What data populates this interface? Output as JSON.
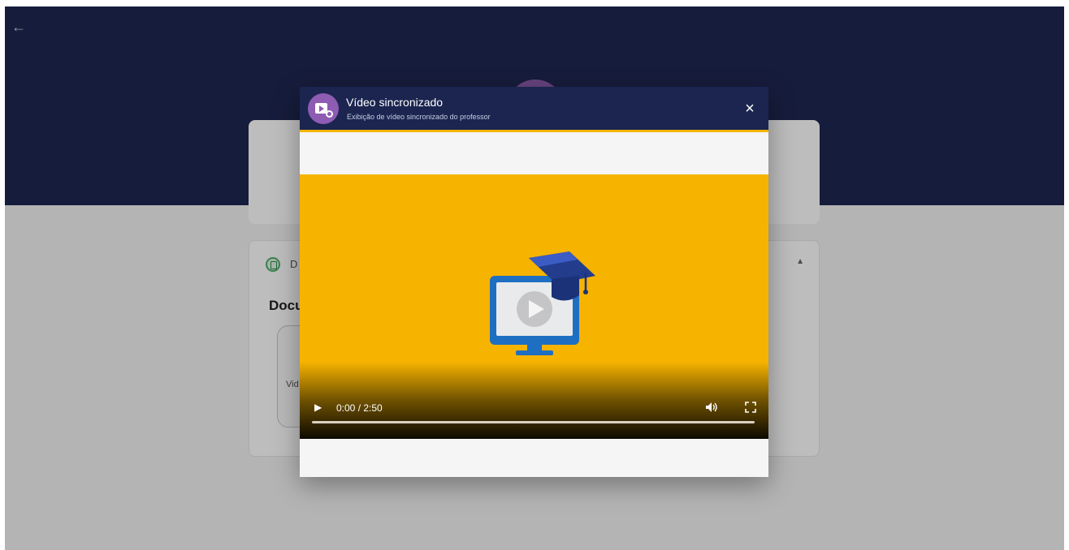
{
  "background": {
    "back_icon": "arrow-left-icon",
    "section_label_partial": "D",
    "document_title_partial": "Docu",
    "video_tile_label_partial": "Vid",
    "header_color": "#1e2650"
  },
  "modal": {
    "title": "Vídeo sincronizado",
    "subtitle": "Exibição de vídeo sincronizado do professor",
    "close_label": "×",
    "header_color": "#1b2550",
    "accent_color": "#f4b400",
    "icon_color": "#8e5cb2"
  },
  "player": {
    "play_label": "▶",
    "time": "0:00 / 2:50",
    "progress": 0,
    "background_color": "#f6b300",
    "volume_icon": "volume-icon",
    "fullscreen_icon": "fullscreen-icon"
  }
}
